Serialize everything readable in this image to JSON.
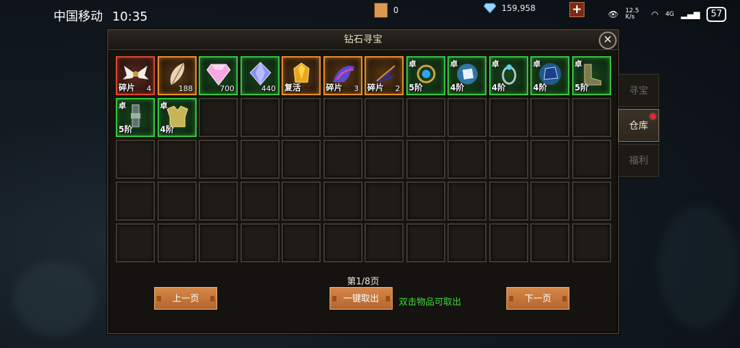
{
  "status_bar": {
    "carrier": "中国移动",
    "time": "10:35",
    "net_speed": "12.5 K/s",
    "signal": "4G",
    "battery": "57"
  },
  "resources": {
    "scroll_count": "0",
    "diamond_count": "159,958"
  },
  "panel": {
    "title": "钻石寻宝",
    "close_icon": "close-icon"
  },
  "items": [
    {
      "quality": "red",
      "icon": "wings-fragment",
      "tl": "",
      "bl": "碎片",
      "br": "4"
    },
    {
      "quality": "orange",
      "icon": "feather",
      "tl": "",
      "bl": "",
      "br": "188"
    },
    {
      "quality": "green",
      "icon": "pink-diamond",
      "tl": "",
      "bl": "",
      "br": "700"
    },
    {
      "quality": "green",
      "icon": "blue-diamond",
      "tl": "",
      "bl": "",
      "br": "440"
    },
    {
      "quality": "orange",
      "icon": "revive-token",
      "tl": "",
      "bl": "复活",
      "br": ""
    },
    {
      "quality": "orange",
      "icon": "dragon-fragment",
      "tl": "",
      "bl": "碎片",
      "br": "3"
    },
    {
      "quality": "orange",
      "icon": "phoenix-fragment",
      "tl": "",
      "bl": "碎片",
      "br": "2"
    },
    {
      "quality": "green",
      "icon": "amulet",
      "tl": "卓",
      "bl": "5阶",
      "br": ""
    },
    {
      "quality": "green",
      "icon": "blue-gem",
      "tl": "卓",
      "bl": "4阶",
      "br": ""
    },
    {
      "quality": "green",
      "icon": "ring",
      "tl": "卓",
      "bl": "4阶",
      "br": ""
    },
    {
      "quality": "green",
      "icon": "crystal-orb",
      "tl": "卓",
      "bl": "4阶",
      "br": ""
    },
    {
      "quality": "green",
      "icon": "boots",
      "tl": "卓",
      "bl": "5阶",
      "br": ""
    },
    {
      "quality": "green",
      "icon": "belt",
      "tl": "卓",
      "bl": "5阶",
      "br": ""
    },
    {
      "quality": "green",
      "icon": "armor",
      "tl": "卓",
      "bl": "4阶",
      "br": ""
    }
  ],
  "total_slots": 60,
  "pagination": {
    "page_label": "第1/8页",
    "prev_label": "上一页",
    "next_label": "下一页"
  },
  "actions": {
    "take_all_label": "一键取出",
    "hint": "双击物品可取出"
  },
  "tabs": [
    {
      "label": "寻宝",
      "active": false
    },
    {
      "label": "仓库",
      "active": true
    },
    {
      "label": "福利",
      "active": false
    }
  ],
  "colors": {
    "red": "#e04632",
    "orange": "#e8902c",
    "green": "#39c446",
    "hint_green": "#3ddb3a",
    "button": "#c77638"
  }
}
